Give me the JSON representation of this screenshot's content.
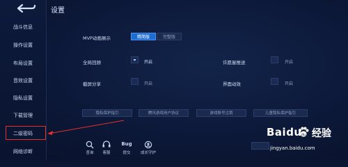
{
  "title": "设置",
  "sidebar": {
    "items": [
      {
        "label": "战斗信息"
      },
      {
        "label": "操作设置"
      },
      {
        "label": "布局设置"
      },
      {
        "label": "音效设置"
      },
      {
        "label": "隐私设置"
      },
      {
        "label": "下载管理"
      },
      {
        "label": "二级密码"
      },
      {
        "label": "网络诊断"
      }
    ]
  },
  "settings": {
    "mvp": {
      "label": "MVP动画展示",
      "options": [
        "精简版",
        "完整版"
      ],
      "selected": "精简版"
    },
    "full_team_replay": {
      "label": "全局回顾",
      "state": "开启",
      "checked": true
    },
    "match_push": {
      "label": "许愿屋推送",
      "state": "开启",
      "checked": false
    },
    "screenshot_share": {
      "label": "截屏分享",
      "state": "开启",
      "checked": false
    },
    "ui_animation": {
      "label": "界面动效",
      "state": "开启",
      "checked": false
    }
  },
  "policy_buttons": [
    "隐私保护指引",
    "腾讯游戏用户协议",
    "游戏账号注销",
    "儿童隐私保护指引"
  ],
  "bottom_icons": [
    {
      "label": "查询",
      "icon": "search-icon"
    },
    {
      "label": "客服",
      "icon": "customer-service-icon"
    },
    {
      "label": "提交",
      "icon": "bug-icon",
      "badge": "Bug"
    },
    {
      "label": "成长守护",
      "icon": "growth-guardian-icon"
    }
  ],
  "watermark": {
    "brand": "Baidu",
    "brand_suffix": "经验",
    "url": "jingyan.baidu.com"
  },
  "colors": {
    "accent": "#1e6dd3",
    "highlight": "#e53030",
    "background": "#0c1838"
  }
}
